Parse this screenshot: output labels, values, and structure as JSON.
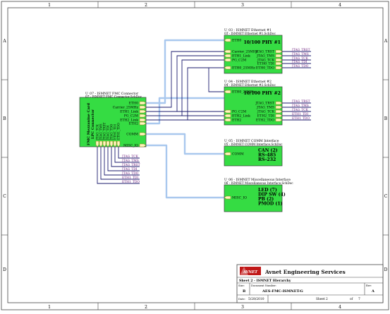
{
  "frame": {
    "columns": [
      "1",
      "2",
      "3",
      "4"
    ],
    "rows": [
      "A",
      "B",
      "C",
      "D"
    ]
  },
  "blocks": {
    "fmc": {
      "designator": "U_07 - ISMNET FMC Connector",
      "file": "07 - ISMNET FMC Connector.SchDoc",
      "body_text": [
        "FMC Mezzanine Card",
        "LPC Connector"
      ],
      "left_pins": [
        "ETH0",
        "Carrier_25MHz",
        "ETH1_Link",
        "PG_C2M",
        "ETH2_Link",
        "ETH2"
      ],
      "right_pins": [
        "COMM",
        "MISC_IO"
      ],
      "bottom_pins": [
        "JTAG_TCK",
        "JTAG_TMS",
        "JTAG_TRST",
        "JTAG_TDI",
        "JTAG_TDO",
        "ETH1_TDI",
        "ETH1_TDO"
      ],
      "bottom_nets": [
        "JTAG_TCK",
        "JTAG_TMS",
        "JTAG_TRST",
        "JTAG_TDI",
        "JTAG_TDO",
        "ETH1_TDI",
        "ETH1_TDO"
      ]
    },
    "eth1": {
      "designator": "U_03 - ISMNET Ethernet #1",
      "file": "03 - ISMNET Ethernet #1.SchDoc",
      "title": "10/100 PHY #1",
      "left_pins": [
        "ETH0",
        "Carrier_25MHz",
        "ETH1_Link",
        "PG_C2M",
        "ETH0_25MHz"
      ],
      "right_pins": [
        "JTAG_TRST",
        "JTAG_TMS",
        "JTAG_TCK",
        "ETH0_TDI",
        "ETH0_TDO"
      ],
      "nets": [
        "JTAG_TRST",
        "JTAG_TMS",
        "JTAG_TCK",
        "JTAG_TDI",
        "JTAG_TDO"
      ]
    },
    "eth2": {
      "designator": "U_04 - ISMNET Ethernet #2",
      "file": "04 - ISMNET Ethernet #2.SchDoc",
      "title": "10/100 PHY #2",
      "left_pins": [
        "ETH0_25MHz",
        "PG_C2M",
        "ETH2_Link",
        "ETH2"
      ],
      "right_pins": [
        "JTAG_TRST",
        "JTAG_TMS",
        "JTAG_TCK",
        "ETH2_TDI",
        "ETH2_TDO"
      ],
      "nets": [
        "JTAG_TRST",
        "JTAG_TMS",
        "JTAG_TCK",
        "ETH1_TDI",
        "ETH1_TDO"
      ]
    },
    "comm": {
      "designator": "U_05 - ISMNET COMM Interface",
      "file": "05 - ISMNET COMM Interface.SchDoc",
      "body_text": [
        "CAN (2)",
        "RS-485",
        "RS-232"
      ],
      "left_pins": [
        "COMM"
      ]
    },
    "misc": {
      "designator": "U_06 - ISMNET Miscellaneous Interface",
      "file": "06 - ISMNET Miscellaneous Interface.SchDoc",
      "body_text": [
        "LED (7)",
        "DIP SW (4)",
        "PB (2)",
        "PMOD (1)"
      ],
      "left_pins": [
        "MISC_IO"
      ]
    }
  },
  "title_block": {
    "company": "Avnet Engineering Services",
    "logo_text": "AVNET",
    "sheet_title": "Sheet 2 - ISMNET Hierarchy",
    "size_label": "Size:",
    "size": "B",
    "docnum_label": "Document Number:",
    "docnum": "AES-FMC-ISMNET-G",
    "rev_label": "Rev:",
    "rev": "A",
    "date_label": "Date:",
    "date": "5/28/2010",
    "sheet_label": "Sheet",
    "sheet": "2",
    "of_label": "of",
    "of": "7"
  },
  "colors": {
    "block_fill": "#35dc43",
    "bus": "#a9c8ee",
    "wire": "#1b1b6e",
    "port_fill": "#fff6bf",
    "port_stroke": "#9a7a10",
    "frame": "#444444",
    "logo": "#c01818"
  }
}
